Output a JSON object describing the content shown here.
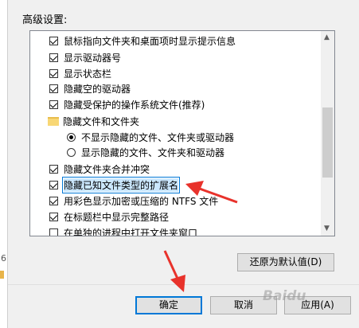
{
  "section_title": "高级设置:",
  "outer_left_number": "6",
  "items": [
    {
      "type": "checkbox",
      "checked": true,
      "label": "鼠标指向文件夹和桌面项时显示提示信息"
    },
    {
      "type": "checkbox",
      "checked": true,
      "label": "显示驱动器号"
    },
    {
      "type": "checkbox",
      "checked": true,
      "label": "显示状态栏"
    },
    {
      "type": "checkbox",
      "checked": true,
      "label": "隐藏空的驱动器"
    },
    {
      "type": "checkbox",
      "checked": true,
      "label": "隐藏受保护的操作系统文件(推荐)"
    },
    {
      "type": "folder",
      "label": "隐藏文件和文件夹"
    },
    {
      "type": "radio",
      "selected": true,
      "label": "不显示隐藏的文件、文件夹或驱动器"
    },
    {
      "type": "radio",
      "selected": false,
      "label": "显示隐藏的文件、文件夹和驱动器"
    },
    {
      "type": "checkbox",
      "checked": true,
      "label": "隐藏文件夹合并冲突"
    },
    {
      "type": "checkbox",
      "checked": true,
      "label": "隐藏已知文件类型的扩展名",
      "highlighted": true
    },
    {
      "type": "checkbox",
      "checked": true,
      "label": "用彩色显示加密或压缩的 NTFS 文件"
    },
    {
      "type": "checkbox",
      "checked": true,
      "label": "在标题栏中显示完整路径"
    },
    {
      "type": "checkbox",
      "checked": false,
      "label": "在单独的进程中打开文件夹窗口"
    }
  ],
  "buttons": {
    "restore_defaults": "还原为默认值(D)",
    "ok": "确定",
    "cancel": "取消",
    "apply": "应用(A)"
  },
  "watermark": "Baidu",
  "annotation_color": "#e8322b"
}
